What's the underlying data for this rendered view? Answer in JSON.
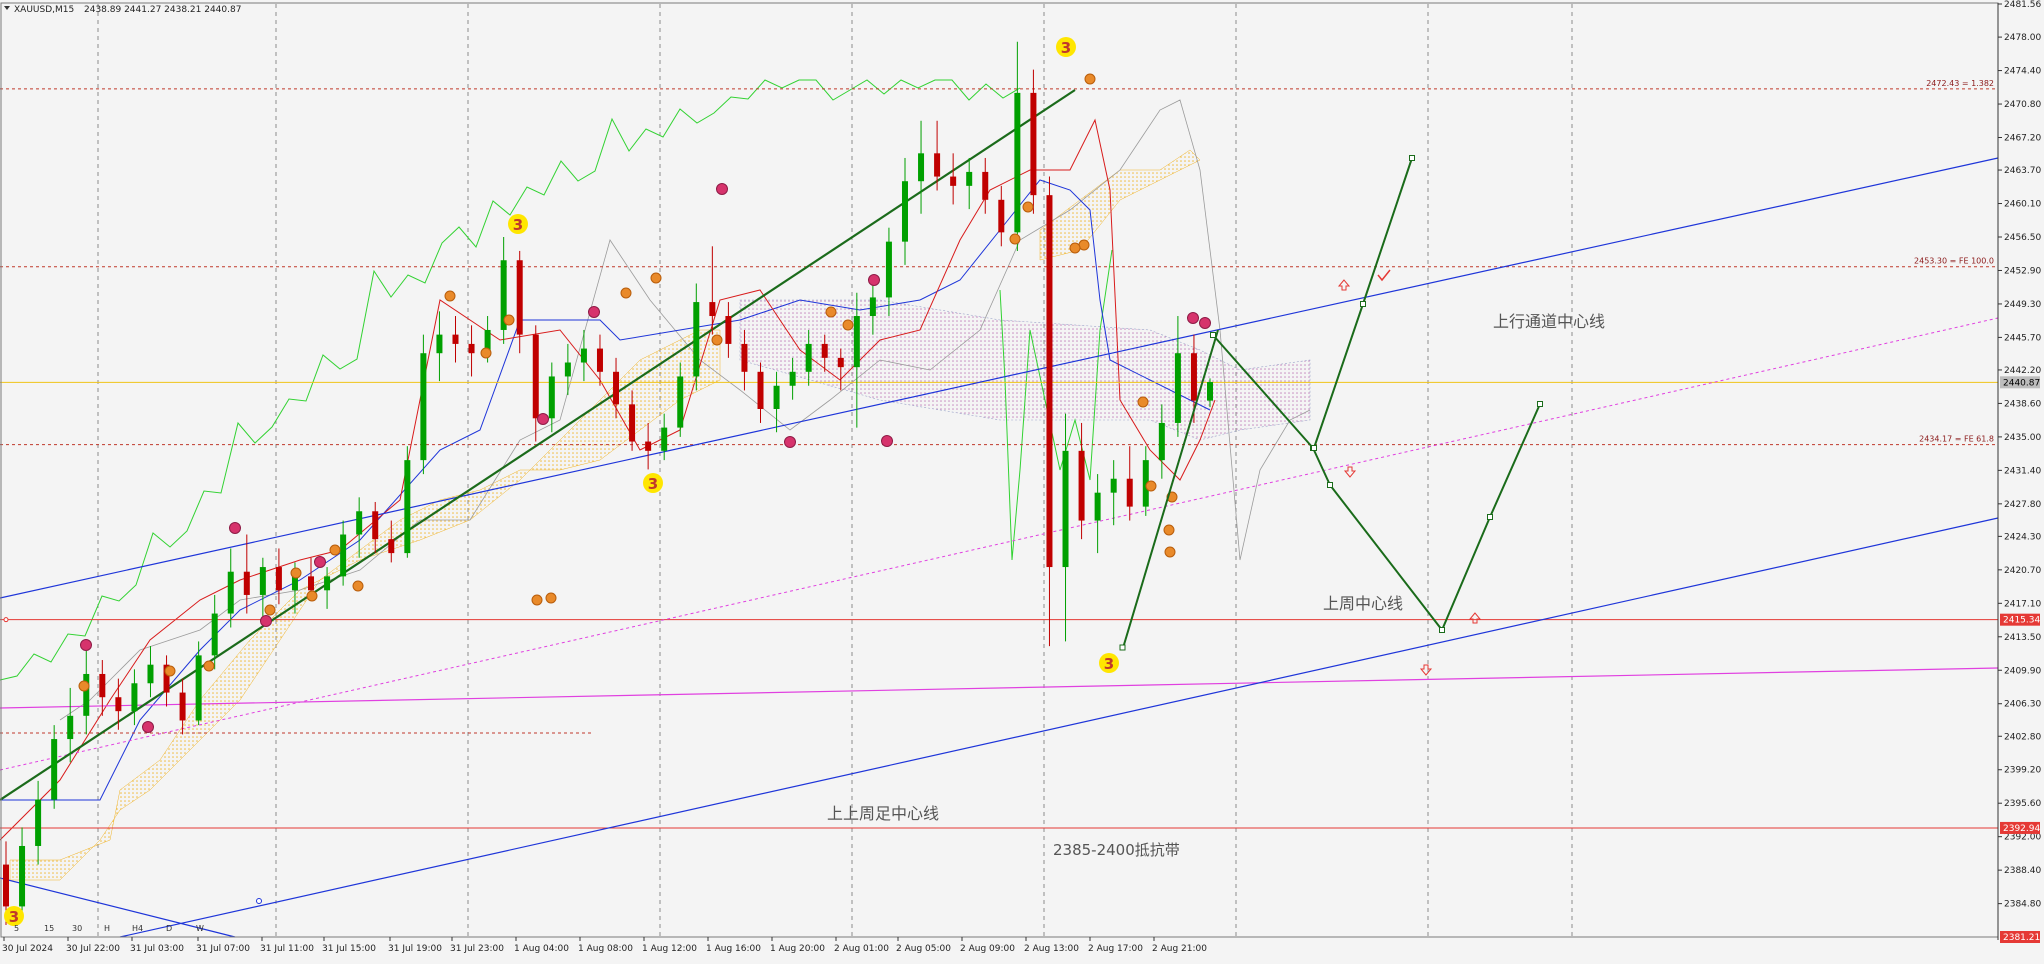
{
  "header": {
    "symbol": "XAUUSD,M15",
    "ohlc": "2438.89 2441.27 2438.21 2440.87"
  },
  "chart_data": {
    "type": "candlestick",
    "symbol": "XAUUSD",
    "timeframe": "M15",
    "ylim": [
      2381.21,
      2481.56
    ],
    "y_ticks": [
      "2481.56",
      "2478.00",
      "2474.40",
      "2470.80",
      "2467.20",
      "2463.70",
      "2460.10",
      "2456.50",
      "2452.90",
      "2449.30",
      "2445.70",
      "2442.20",
      "2438.60",
      "2435.00",
      "2431.40",
      "2427.80",
      "2424.30",
      "2420.70",
      "2417.10",
      "2413.50",
      "2409.90",
      "2406.30",
      "2402.80",
      "2399.20",
      "2395.60",
      "2392.00",
      "2388.40",
      "2384.80"
    ],
    "x_ticks": [
      "30 Jul 2024",
      "30 Jul 22:00",
      "31 Jul 03:00",
      "31 Jul 07:00",
      "31 Jul 11:00",
      "31 Jul 15:00",
      "31 Jul 19:00",
      "31 Jul 23:00",
      "1 Aug 04:00",
      "1 Aug 08:00",
      "1 Aug 12:00",
      "1 Aug 16:00",
      "1 Aug 20:00",
      "2 Aug 01:00",
      "2 Aug 05:00",
      "2 Aug 09:00",
      "2 Aug 13:00",
      "2 Aug 17:00",
      "2 Aug 21:00"
    ],
    "timeframe_buttons": [
      "5",
      "15",
      "30",
      "H",
      "H4",
      "D",
      "W"
    ],
    "current_price": "2440.87",
    "price_labels": [
      "2415.34",
      "2392.94",
      "2381.21"
    ],
    "levels": [
      {
        "price": 2472.43,
        "label": "2472.43 = 1.382",
        "style": "dashed",
        "color": "#c0392b"
      },
      {
        "price": 2453.3,
        "label": "2453.30 = FE 100.0",
        "style": "dashed",
        "color": "#c0392b"
      },
      {
        "price": 2434.17,
        "label": "2434.17 = FE 61.8",
        "style": "dashed",
        "color": "#c0392b"
      },
      {
        "price": 2440.87,
        "label": "",
        "style": "solid",
        "color": "#f0c419"
      },
      {
        "price": 2415.34,
        "label": "",
        "style": "solid",
        "color": "#e53935"
      },
      {
        "price": 2392.94,
        "label": "",
        "style": "solid",
        "color": "#e53935"
      }
    ],
    "annotations": [
      "上行通道中心线",
      "上周中心线",
      "上上周足中心线",
      "2385-2400抵抗带"
    ],
    "wave_labels": [
      "3",
      "3",
      "3",
      "3",
      "3"
    ],
    "projection_path": [
      2446.7,
      2434.2,
      2429.9,
      2415.3,
      2426.7,
      2438.8
    ],
    "projection_path_alt": [
      2434.2,
      2449.8,
      2465.3
    ],
    "candles": [
      {
        "o": 2389.0,
        "h": 2391.5,
        "l": 2382.5,
        "c": 2384.5
      },
      {
        "o": 2384.5,
        "h": 2393.0,
        "l": 2383.0,
        "c": 2391.0
      },
      {
        "o": 2391.0,
        "h": 2398.0,
        "l": 2389.0,
        "c": 2396.0
      },
      {
        "o": 2396.0,
        "h": 2404.0,
        "l": 2395.0,
        "c": 2402.5
      },
      {
        "o": 2402.5,
        "h": 2408.0,
        "l": 2400.0,
        "c": 2405.0
      },
      {
        "o": 2405.0,
        "h": 2412.0,
        "l": 2403.0,
        "c": 2409.5
      },
      {
        "o": 2409.5,
        "h": 2411.0,
        "l": 2405.0,
        "c": 2407.0
      },
      {
        "o": 2407.0,
        "h": 2409.0,
        "l": 2403.5,
        "c": 2405.5
      },
      {
        "o": 2405.5,
        "h": 2410.0,
        "l": 2404.0,
        "c": 2408.5
      },
      {
        "o": 2408.5,
        "h": 2412.5,
        "l": 2407.0,
        "c": 2410.5
      },
      {
        "o": 2410.5,
        "h": 2411.5,
        "l": 2406.0,
        "c": 2407.5
      },
      {
        "o": 2407.5,
        "h": 2409.0,
        "l": 2403.0,
        "c": 2404.5
      },
      {
        "o": 2404.5,
        "h": 2413.0,
        "l": 2404.0,
        "c": 2411.5
      },
      {
        "o": 2411.5,
        "h": 2418.0,
        "l": 2410.0,
        "c": 2416.0
      },
      {
        "o": 2416.0,
        "h": 2423.0,
        "l": 2414.5,
        "c": 2420.5
      },
      {
        "o": 2420.5,
        "h": 2424.5,
        "l": 2416.0,
        "c": 2418.0
      },
      {
        "o": 2418.0,
        "h": 2422.0,
        "l": 2415.5,
        "c": 2421.0
      },
      {
        "o": 2421.0,
        "h": 2423.0,
        "l": 2417.0,
        "c": 2418.5
      },
      {
        "o": 2418.5,
        "h": 2421.5,
        "l": 2416.0,
        "c": 2420.0
      },
      {
        "o": 2420.0,
        "h": 2422.0,
        "l": 2417.5,
        "c": 2418.5
      },
      {
        "o": 2418.5,
        "h": 2421.0,
        "l": 2416.5,
        "c": 2420.0
      },
      {
        "o": 2420.0,
        "h": 2426.0,
        "l": 2419.0,
        "c": 2424.5
      },
      {
        "o": 2424.5,
        "h": 2428.5,
        "l": 2422.0,
        "c": 2427.0
      },
      {
        "o": 2427.0,
        "h": 2428.0,
        "l": 2422.5,
        "c": 2424.0
      },
      {
        "o": 2424.0,
        "h": 2426.0,
        "l": 2421.5,
        "c": 2422.5
      },
      {
        "o": 2422.5,
        "h": 2434.0,
        "l": 2422.0,
        "c": 2432.5
      },
      {
        "o": 2432.5,
        "h": 2446.0,
        "l": 2431.0,
        "c": 2444.0
      },
      {
        "o": 2444.0,
        "h": 2448.5,
        "l": 2441.0,
        "c": 2446.0
      },
      {
        "o": 2446.0,
        "h": 2448.0,
        "l": 2443.0,
        "c": 2445.0
      },
      {
        "o": 2445.0,
        "h": 2447.0,
        "l": 2441.5,
        "c": 2444.0
      },
      {
        "o": 2444.0,
        "h": 2448.0,
        "l": 2443.0,
        "c": 2446.5
      },
      {
        "o": 2446.5,
        "h": 2456.5,
        "l": 2445.0,
        "c": 2454.0
      },
      {
        "o": 2454.0,
        "h": 2455.0,
        "l": 2444.0,
        "c": 2446.0
      },
      {
        "o": 2446.0,
        "h": 2447.0,
        "l": 2434.5,
        "c": 2437.0
      },
      {
        "o": 2437.0,
        "h": 2443.0,
        "l": 2435.5,
        "c": 2441.5
      },
      {
        "o": 2441.5,
        "h": 2445.0,
        "l": 2439.5,
        "c": 2443.0
      },
      {
        "o": 2443.0,
        "h": 2446.5,
        "l": 2441.0,
        "c": 2444.5
      },
      {
        "o": 2444.5,
        "h": 2446.0,
        "l": 2440.5,
        "c": 2442.0
      },
      {
        "o": 2442.0,
        "h": 2443.5,
        "l": 2437.0,
        "c": 2438.5
      },
      {
        "o": 2438.5,
        "h": 2440.0,
        "l": 2433.5,
        "c": 2434.5
      },
      {
        "o": 2434.5,
        "h": 2436.5,
        "l": 2431.5,
        "c": 2433.5
      },
      {
        "o": 2433.5,
        "h": 2437.5,
        "l": 2432.5,
        "c": 2436.0
      },
      {
        "o": 2436.0,
        "h": 2443.0,
        "l": 2435.0,
        "c": 2441.5
      },
      {
        "o": 2441.5,
        "h": 2451.5,
        "l": 2440.0,
        "c": 2449.5
      },
      {
        "o": 2449.5,
        "h": 2455.5,
        "l": 2446.0,
        "c": 2448.0
      },
      {
        "o": 2448.0,
        "h": 2449.5,
        "l": 2443.5,
        "c": 2445.0
      },
      {
        "o": 2445.0,
        "h": 2446.5,
        "l": 2440.0,
        "c": 2442.0
      },
      {
        "o": 2442.0,
        "h": 2443.0,
        "l": 2436.5,
        "c": 2438.0
      },
      {
        "o": 2438.0,
        "h": 2442.0,
        "l": 2435.5,
        "c": 2440.5
      },
      {
        "o": 2440.5,
        "h": 2443.5,
        "l": 2439.0,
        "c": 2442.0
      },
      {
        "o": 2442.0,
        "h": 2446.5,
        "l": 2440.5,
        "c": 2445.0
      },
      {
        "o": 2445.0,
        "h": 2446.0,
        "l": 2442.0,
        "c": 2443.5
      },
      {
        "o": 2443.5,
        "h": 2444.5,
        "l": 2440.0,
        "c": 2442.5
      },
      {
        "o": 2442.5,
        "h": 2450.5,
        "l": 2436.0,
        "c": 2448.0
      },
      {
        "o": 2448.0,
        "h": 2451.5,
        "l": 2446.0,
        "c": 2450.0
      },
      {
        "o": 2450.0,
        "h": 2457.5,
        "l": 2448.0,
        "c": 2456.0
      },
      {
        "o": 2456.0,
        "h": 2465.0,
        "l": 2453.5,
        "c": 2462.5
      },
      {
        "o": 2462.5,
        "h": 2469.0,
        "l": 2459.0,
        "c": 2465.5
      },
      {
        "o": 2465.5,
        "h": 2469.0,
        "l": 2461.5,
        "c": 2463.0
      },
      {
        "o": 2463.0,
        "h": 2465.5,
        "l": 2460.0,
        "c": 2462.0
      },
      {
        "o": 2462.0,
        "h": 2465.0,
        "l": 2459.5,
        "c": 2463.5
      },
      {
        "o": 2463.5,
        "h": 2465.0,
        "l": 2459.0,
        "c": 2460.5
      },
      {
        "o": 2460.5,
        "h": 2462.0,
        "l": 2455.5,
        "c": 2457.0
      },
      {
        "o": 2457.0,
        "h": 2477.5,
        "l": 2455.0,
        "c": 2472.0
      },
      {
        "o": 2472.0,
        "h": 2474.5,
        "l": 2459.0,
        "c": 2461.0
      },
      {
        "o": 2461.0,
        "h": 2463.0,
        "l": 2412.5,
        "c": 2421.0
      },
      {
        "o": 2421.0,
        "h": 2437.5,
        "l": 2413.0,
        "c": 2433.5
      },
      {
        "o": 2433.5,
        "h": 2436.5,
        "l": 2424.0,
        "c": 2426.0
      },
      {
        "o": 2426.0,
        "h": 2431.0,
        "l": 2422.5,
        "c": 2429.0
      },
      {
        "o": 2429.0,
        "h": 2432.5,
        "l": 2425.5,
        "c": 2430.5
      },
      {
        "o": 2430.5,
        "h": 2434.0,
        "l": 2426.0,
        "c": 2427.5
      },
      {
        "o": 2427.5,
        "h": 2434.0,
        "l": 2426.5,
        "c": 2432.5
      },
      {
        "o": 2432.5,
        "h": 2438.5,
        "l": 2430.5,
        "c": 2436.5
      },
      {
        "o": 2436.5,
        "h": 2448.0,
        "l": 2435.0,
        "c": 2444.0
      },
      {
        "o": 2444.0,
        "h": 2446.0,
        "l": 2436.5,
        "c": 2438.9
      },
      {
        "o": 2438.9,
        "h": 2441.3,
        "l": 2438.2,
        "c": 2440.9
      }
    ]
  }
}
